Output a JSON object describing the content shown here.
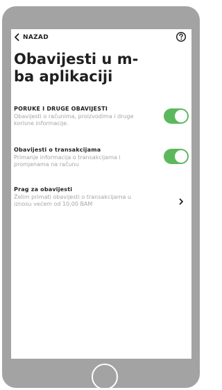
{
  "header": {
    "back_label": "NAZAD",
    "help_icon": "question-circle-icon",
    "back_icon": "chevron-left-icon"
  },
  "page": {
    "title_line1": "Obavijesti u m-",
    "title_line2": "ba aplikaciji"
  },
  "settings": [
    {
      "label": "PORUKE I DRUGE OBAVIJESTI",
      "desc_line1": "Obavijesti o računima, proizvodima i druge",
      "desc_line2": "korisne informacije.",
      "control": "toggle",
      "enabled": true
    },
    {
      "label": "Obavijesti o transakcijama",
      "desc_line1": "Primanje informacija o transakcijama i",
      "desc_line2": "promjenama na računu",
      "control": "toggle",
      "enabled": true
    },
    {
      "label": "Prag za obavijesti",
      "desc_line1": "Želim primati obavijesti o transakcijama u",
      "desc_line2": "iznosu većem od 10,00 BAM",
      "control": "chevron-right-icon"
    }
  ],
  "colors": {
    "toggle_on": "#5cb85c",
    "device_frame": "#a3a3a3",
    "text_primary": "#1f1f1f",
    "text_secondary": "#a5a5a5"
  }
}
